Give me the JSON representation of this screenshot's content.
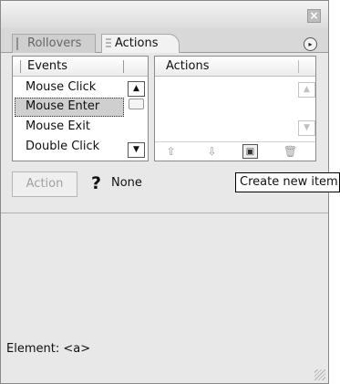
{
  "window": {
    "close_glyph": "×"
  },
  "tabs": [
    {
      "label": "Rollovers"
    },
    {
      "label": "Actions"
    }
  ],
  "panel_menu_glyph": "▸",
  "events": {
    "header": "Events",
    "items": [
      "Mouse Click",
      "Mouse Enter",
      "Mouse Exit",
      "Double Click"
    ],
    "selected_index": 1,
    "scroll_up_glyph": "▲",
    "scroll_down_glyph": "▼"
  },
  "actions": {
    "header": "Actions",
    "scroll_up_glyph": "▲",
    "scroll_down_glyph": "▼",
    "toolbar": {
      "move_up_glyph": "⇧",
      "move_down_glyph": "⇩",
      "create_glyph": "▣",
      "delete_glyph": "🗑"
    }
  },
  "action_row": {
    "button_label": "Action",
    "help_glyph": "?",
    "value": "None"
  },
  "status": {
    "element": "Element: <a>"
  },
  "tooltip": {
    "text": "Create new item"
  },
  "colors": {
    "panel_bg": "#e8e8e8",
    "selection_bg": "#cfcfcf"
  }
}
